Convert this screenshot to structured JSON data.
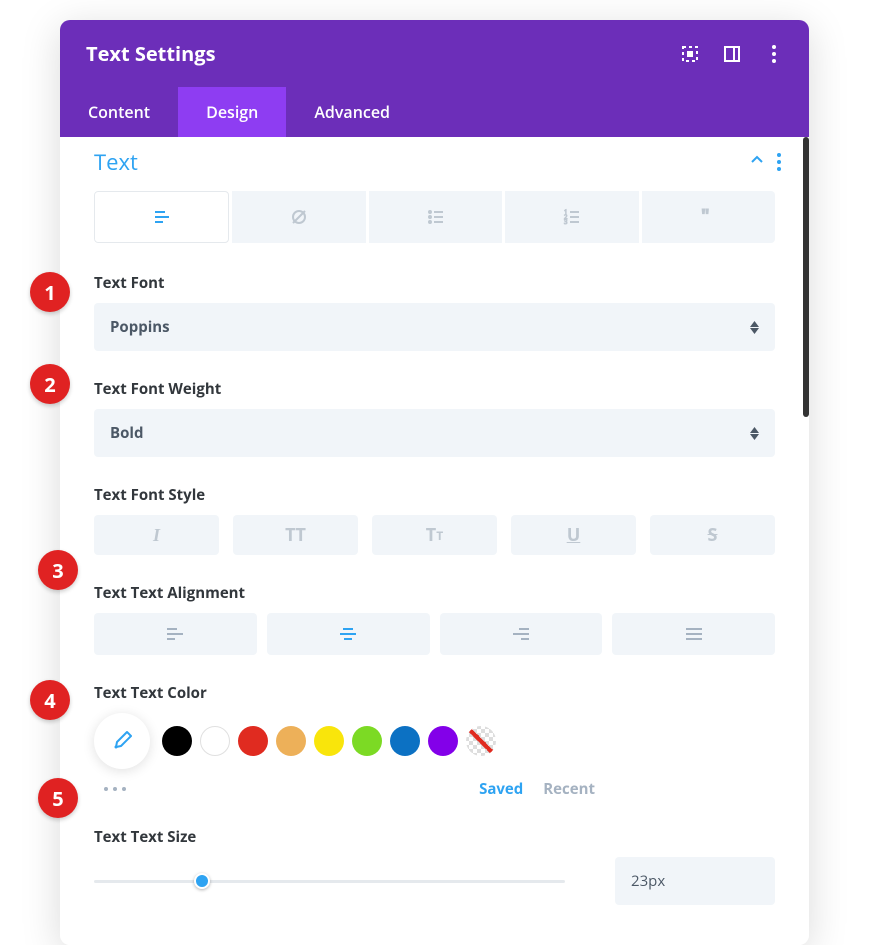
{
  "header": {
    "title": "Text Settings"
  },
  "tabs": {
    "content": "Content",
    "design": "Design",
    "advanced": "Advanced"
  },
  "section": {
    "title": "Text"
  },
  "fields": {
    "font": {
      "label": "Text Font",
      "value": "Poppins"
    },
    "weight": {
      "label": "Text Font Weight",
      "value": "Bold"
    },
    "style": {
      "label": "Text Font Style",
      "italic": "I",
      "uppercase": "TT",
      "smallcaps_t1": "T",
      "smallcaps_t2": "T",
      "underline": "U",
      "strike": "S"
    },
    "alignment": {
      "label": "Text Text Alignment"
    },
    "color": {
      "label": "Text Text Color",
      "saved": "Saved",
      "recent": "Recent",
      "swatches": [
        "#000000",
        "#FFFFFF",
        "#E02B20",
        "#EDB059",
        "#F9E50B",
        "#7CDA24",
        "#0C71C3",
        "#8300E9"
      ]
    },
    "size": {
      "label": "Text Text Size",
      "value": "23px"
    }
  },
  "badges": {
    "b1": "1",
    "b2": "2",
    "b3": "3",
    "b4": "4",
    "b5": "5"
  }
}
